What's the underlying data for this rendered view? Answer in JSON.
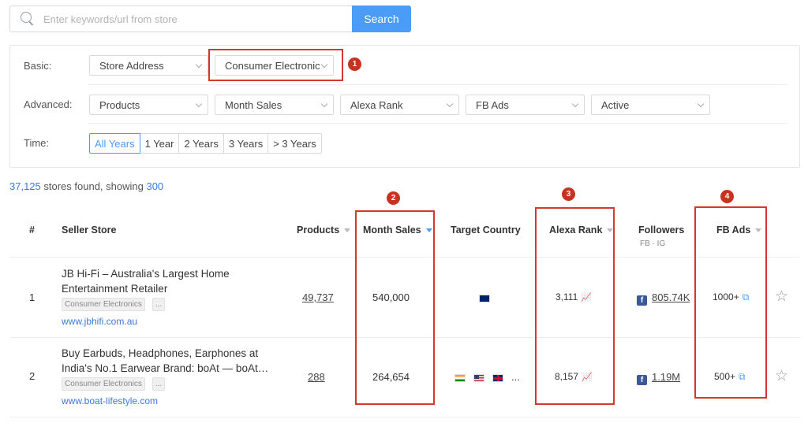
{
  "search": {
    "placeholder": "Enter keywords/url from store",
    "button": "Search"
  },
  "filters": {
    "basic_label": "Basic:",
    "basic": [
      "Store Address",
      "Consumer Electronic"
    ],
    "advanced_label": "Advanced:",
    "advanced": [
      "Products",
      "Month Sales",
      "Alexa Rank",
      "FB Ads",
      "Active"
    ],
    "time_label": "Time:",
    "time": [
      "All Years",
      "1 Year",
      "2 Years",
      "3 Years",
      "> 3 Years"
    ]
  },
  "summary": {
    "count": "37,125",
    "text": " stores found, showing ",
    "showing": "300"
  },
  "columns": {
    "num": "#",
    "seller": "Seller Store",
    "products": "Products",
    "month_sales": "Month Sales",
    "country": "Target Country",
    "alexa": "Alexa Rank",
    "followers": "Followers",
    "fb_ig": "FB · IG",
    "fb_ads": "FB Ads"
  },
  "rows": [
    {
      "num": "1",
      "title": "JB Hi-Fi – Australia's Largest Home Entertainment Retailer",
      "tag": "Consumer Electronics",
      "more": "...",
      "url": "www.jbhifi.com.au",
      "products": "49,737",
      "sales": "540,000",
      "countries": "",
      "alexa": "3,111",
      "followers": "805.74K",
      "ads": "1000+"
    },
    {
      "num": "2",
      "title": "Buy Earbuds, Headphones, Earphones at India's No.1 Earwear Brand: boAt — boAt…",
      "tag": "Consumer Electronics",
      "more": "...",
      "url": "www.boat-lifestyle.com",
      "products": "288",
      "sales": "264,654",
      "countries": "...",
      "alexa": "8,157",
      "followers": "1.19M",
      "ads": "500+"
    }
  ],
  "badges": [
    "1",
    "2",
    "3",
    "4"
  ],
  "colors": {
    "accent": "#4a9cf6",
    "annotation": "#d43a2b",
    "facebook": "#3b5998"
  }
}
